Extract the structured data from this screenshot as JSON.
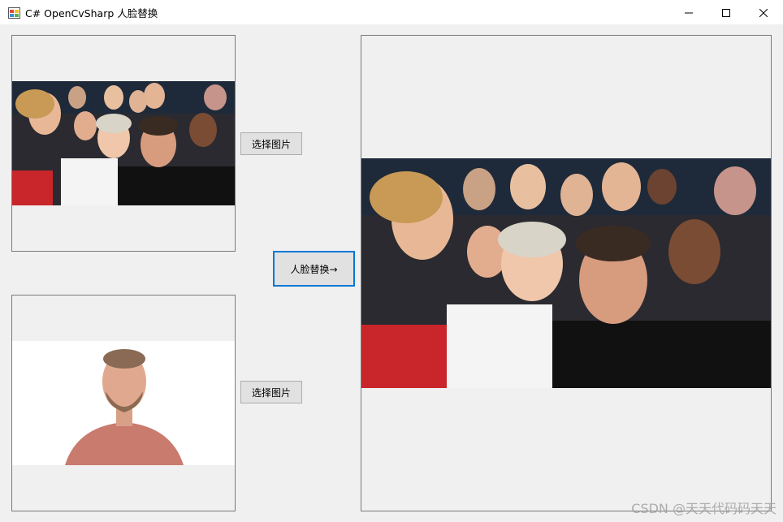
{
  "window": {
    "title": "C# OpenCvSharp 人脸替换",
    "app_icon": "winforms-app-icon",
    "controls": [
      "minimize-icon",
      "maximize-icon",
      "close-icon"
    ]
  },
  "source_image": {
    "content": "group selfie photo of smiling people at an event"
  },
  "target_image": {
    "content": "portrait photo of a bearded man in a salmon shirt on white background"
  },
  "result_image": {
    "content": "group selfie photo of smiling people at an event"
  },
  "buttons": {
    "select_source": "选择图片",
    "select_target": "选择图片",
    "face_swap": "人脸替换→"
  },
  "watermark": "CSDN @天天代码码天天",
  "colors": {
    "window_bg": "#f0f0f0",
    "button_bg": "#e1e1e1",
    "focus_border": "#0078d7"
  }
}
